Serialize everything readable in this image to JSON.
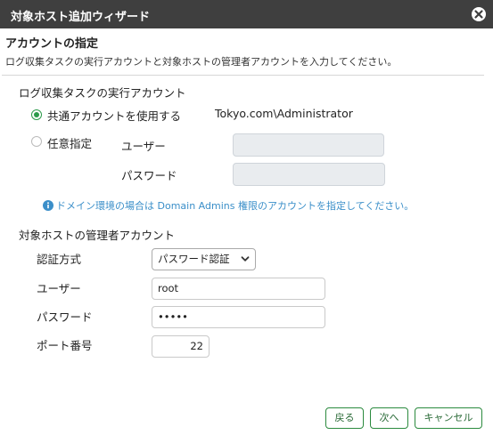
{
  "window": {
    "title": "対象ホスト追加ウィザード",
    "close_icon": "close-circle-icon"
  },
  "header": {
    "title": "アカウントの指定",
    "description": "ログ収集タスクの実行アカウントと対象ホストの管理者アカウントを入力してください。"
  },
  "collect_account": {
    "title": "ログ収集タスクの実行アカウント",
    "shared_option": {
      "label": "共通アカウントを使用する",
      "value": "Tokyo.com\\Administrator",
      "checked": true
    },
    "custom_option": {
      "label": "任意指定",
      "checked": false
    },
    "user_label": "ユーザー",
    "user_value": "",
    "password_label": "パスワード",
    "password_value": "",
    "info_icon": "info-icon",
    "info_text": "ドメイン環境の場合は Domain Admins 権限のアカウントを指定してください。"
  },
  "admin_account": {
    "title": "対象ホストの管理者アカウント",
    "auth_label": "認証方式",
    "auth_value": "パスワード認証",
    "user_label": "ユーザー",
    "user_value": "root",
    "password_label": "パスワード",
    "password_value": "•••••",
    "port_label": "ポート番号",
    "port_value": "22"
  },
  "footer": {
    "back": "戻る",
    "next": "次へ",
    "cancel": "キャンセル"
  },
  "colors": {
    "titlebar": "#3f3f3f",
    "accent": "#2b9a4a",
    "info": "#3b8fc9"
  }
}
